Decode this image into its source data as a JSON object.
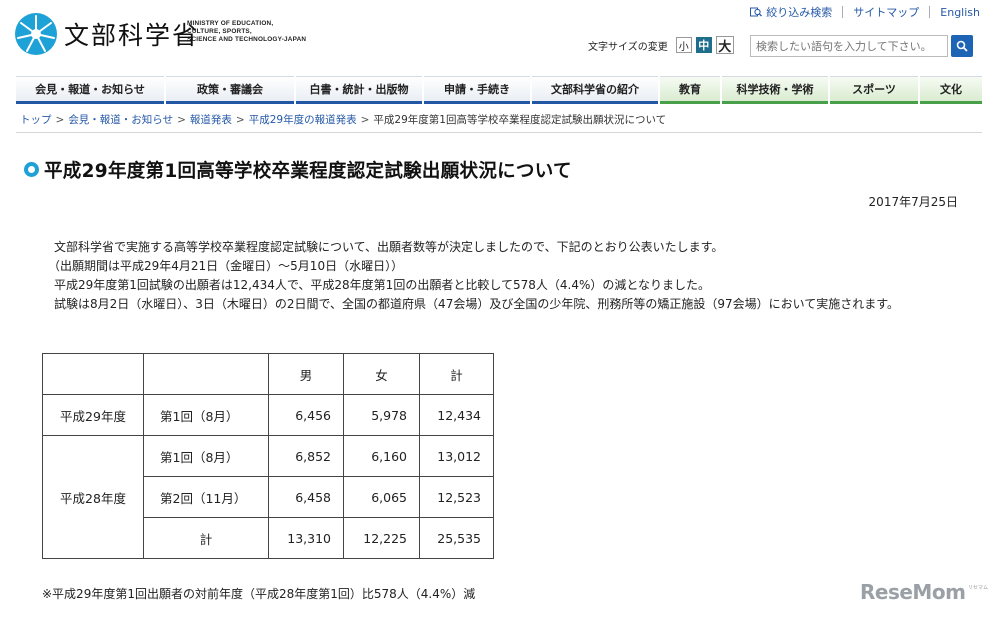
{
  "header": {
    "logo_title": "文部科学省",
    "logo_sub": [
      "MINISTRY OF EDUCATION,",
      "CULTURE, SPORTS,",
      "SCIENCE AND TECHNOLOGY-JAPAN"
    ],
    "top_links": [
      "絞り込み検索",
      "サイトマップ",
      "English"
    ],
    "font_size_label": "文字サイズの変更",
    "font_size_buttons": [
      "小",
      "中",
      "大"
    ],
    "search_placeholder": "検索したい語句を入力して下さい。"
  },
  "nav": {
    "items": [
      "会見・報道・お知らせ",
      "政策・審議会",
      "白書・統計・出版物",
      "申請・手続き",
      "文部科学省の紹介",
      "教育",
      "科学技術・学術",
      "スポーツ",
      "文化"
    ]
  },
  "breadcrumb": {
    "items": [
      "トップ",
      "会見・報道・お知らせ",
      "報道発表",
      "平成29年度の報道発表"
    ],
    "current": "平成29年度第1回高等学校卒業程度認定試験出願状況について"
  },
  "page": {
    "title": "平成29年度第1回高等学校卒業程度認定試験出願状況について",
    "date": "2017年7月25日",
    "paragraphs": [
      "　文部科学省で実施する高等学校卒業程度認定試験について、出願者数等が決定しましたので、下記のとおり公表いたします。",
      "　（出願期間は平成29年4月21日（金曜日）～5月10日（水曜日））",
      "　平成29年度第1回試験の出願者は12,434人で、平成28年度第1回の出願者と比較して578人（4.4%）の減となりました。",
      "　試験は8月2日（水曜日）、3日（木曜日）の2日間で、全国の都道府県（47会場）及び全国の少年院、刑務所等の矯正施設（97会場）において実施されます。"
    ],
    "note": "※平成29年度第1回出願者の対前年度（平成28年度第1回）比578人（4.4%）減"
  },
  "table": {
    "headers": [
      "男",
      "女",
      "計"
    ],
    "rows": [
      {
        "year": "平成29年度",
        "session": "第1回（8月）",
        "male": "6,456",
        "female": "5,978",
        "total": "12,434"
      },
      {
        "year": "平成28年度",
        "session": "第1回（8月）",
        "male": "6,852",
        "female": "6,160",
        "total": "13,012"
      },
      {
        "year": "",
        "session": "第2回（11月）",
        "male": "6,458",
        "female": "6,065",
        "total": "12,523"
      },
      {
        "year": "",
        "session": "計",
        "male": "13,310",
        "female": "12,225",
        "total": "25,535"
      }
    ]
  },
  "watermark": {
    "text": "ReseMom",
    "small": "リセマム"
  },
  "colors": {
    "nav_blue": "#2356a4",
    "nav_green": "#4aa04a",
    "accent_cyan": "#1ea1d6",
    "link": "#2559a8"
  }
}
